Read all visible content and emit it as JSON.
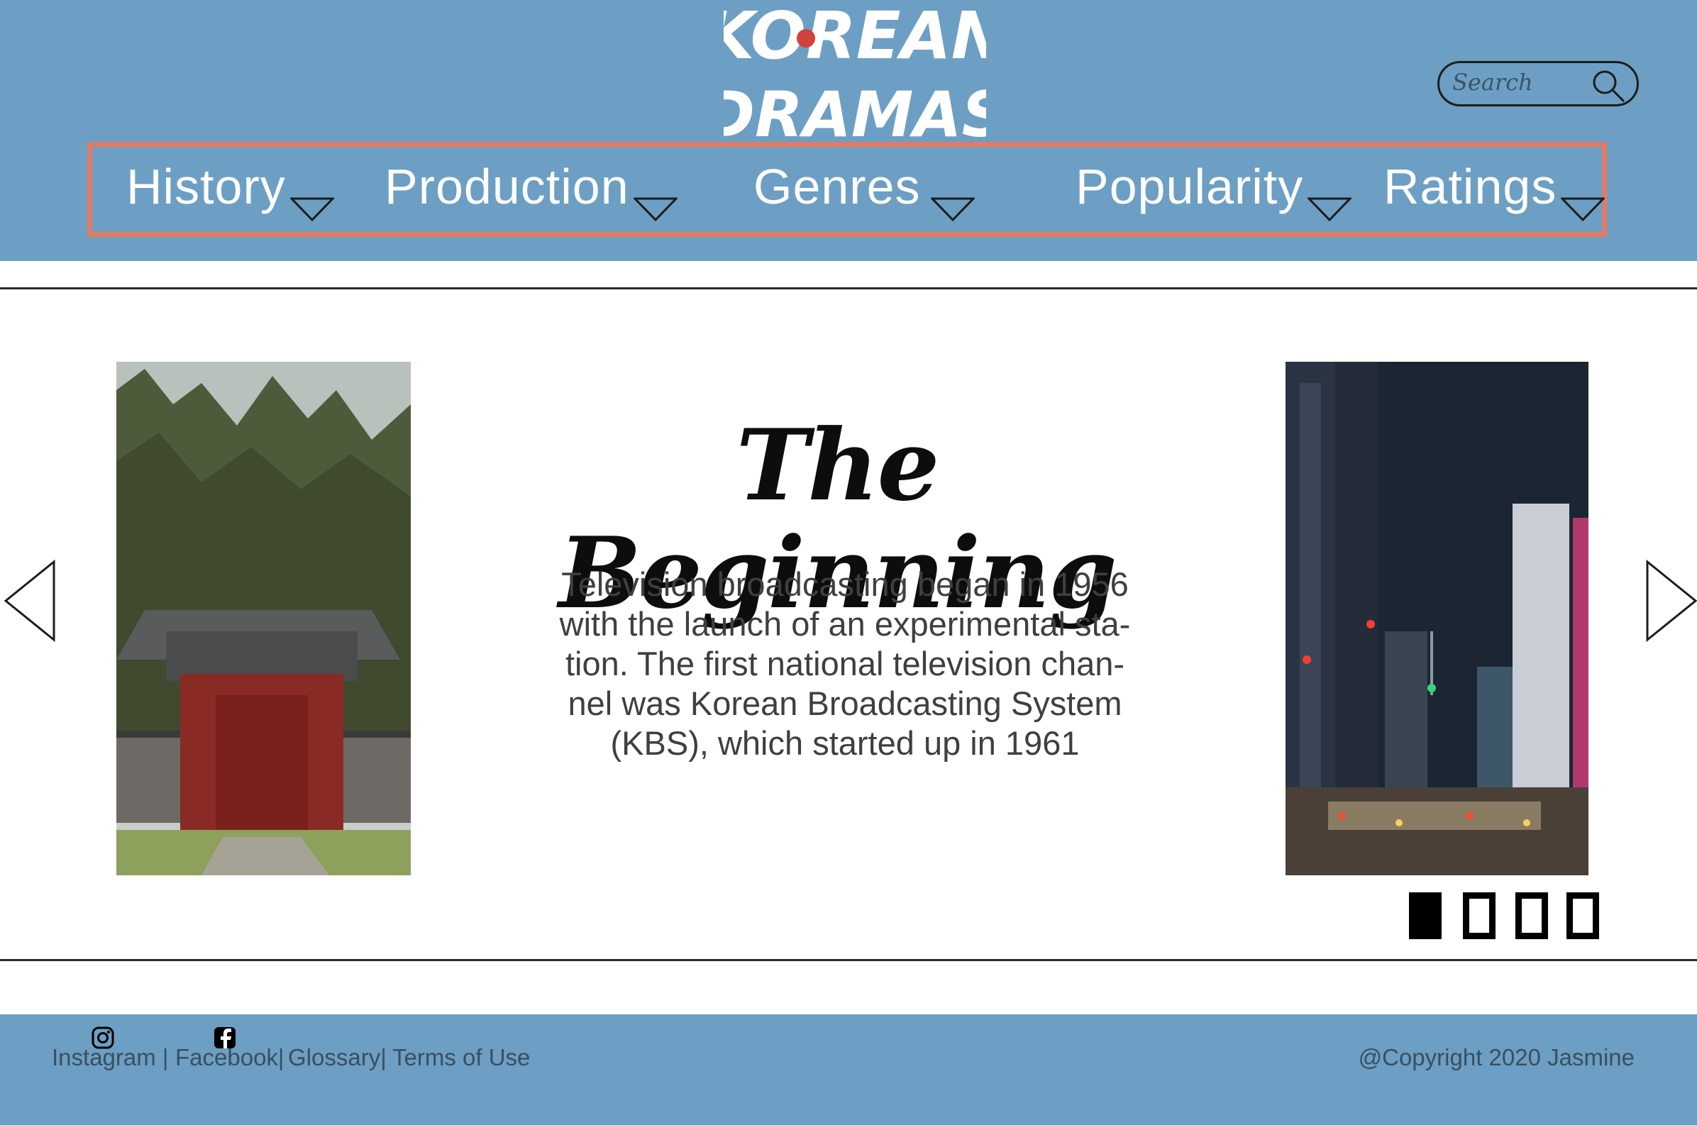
{
  "header": {
    "logo": {
      "line1": "KOREAN",
      "line2": "DRAMAS"
    },
    "search": {
      "placeholder": "Search",
      "icon": "search-icon"
    },
    "nav": [
      {
        "label": "History",
        "icon": "caret-down-icon"
      },
      {
        "label": "Production",
        "icon": "caret-down-icon"
      },
      {
        "label": "Genres",
        "icon": "caret-down-icon"
      },
      {
        "label": "Popularity",
        "icon": "caret-down-icon"
      },
      {
        "label": "Ratings",
        "icon": "caret-down-icon"
      }
    ]
  },
  "slide": {
    "title": "The Beginning",
    "text": "Television broadcasting began in 1956\nwith the launch of an experimental sta-\ntion. The first national television chan-\nnel was Korean Broadcasting System\n(KBS), which started up in 1961",
    "left_image": "traditional-korean-gate-photo",
    "right_image": "seoul-night-city-photo",
    "prev_icon": "left-arrow-icon",
    "next_icon": "right-arrow-icon",
    "indicators": {
      "count": 4,
      "active": 1
    }
  },
  "footer": {
    "links": [
      {
        "label": "Instagram |",
        "icon": "instagram-icon"
      },
      {
        "label": "Facebook|",
        "icon": "facebook-icon"
      },
      {
        "label": "Glossary|"
      },
      {
        "label": "Terms of Use"
      }
    ],
    "copyright": "@Copyright 2020 Jasmine"
  },
  "colors": {
    "header_bg": "#6c9fc3",
    "nav_border": "#e07b66",
    "text_dark": "#0d0d0d"
  }
}
